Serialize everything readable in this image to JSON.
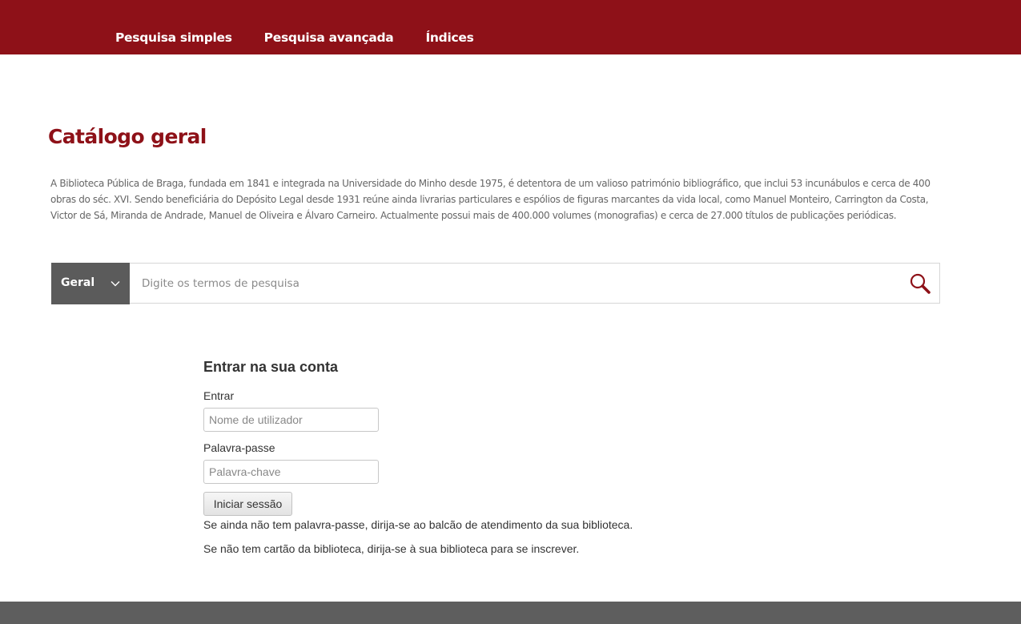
{
  "nav": {
    "items": [
      "Pesquisa simples",
      "Pesquisa avançada",
      "Índices"
    ]
  },
  "page": {
    "title": "Catálogo geral",
    "intro": "A Biblioteca Pública de Braga, fundada em 1841 e integrada na Universidade do Minho desde 1975, é detentora de um valioso património bibliográfico, que inclui 53 incunábulos e cerca de 400 obras do séc. XVI. Sendo beneficiária do Depósito Legal desde 1931 reúne ainda livrarias particulares e espólios de figuras marcantes da vida local, como Manuel Monteiro, Carrington da Costa, Victor de Sá, Miranda de Andrade, Manuel de Oliveira e Álvaro Carneiro. Actualmente possui mais de 400.000 volumes (monografias) e cerca de 27.000 títulos de publicações periódicas."
  },
  "search": {
    "scope": "Geral",
    "placeholder": "Digite os termos de pesquisa",
    "value": "",
    "search_icon": "search-icon",
    "chevron_icon": "chevron-down-icon"
  },
  "login": {
    "heading": "Entrar na sua conta",
    "username_label": "Entrar",
    "username_placeholder": "Nome de utilizador",
    "password_label": "Palavra-passe",
    "password_placeholder": "Palavra-chave",
    "submit_label": "Iniciar sessão",
    "note_password": "Se ainda não tem palavra-passe, dirija-se ao balcão de atendimento da sua biblioteca.",
    "note_card": "Se não tem cartão da biblioteca, dirija-se à sua biblioteca para se inscrever."
  },
  "colors": {
    "brand": "#8e1118",
    "scope_bg": "#5b5b5b",
    "footer_bg": "#5e5e5e",
    "text": "#333333"
  }
}
